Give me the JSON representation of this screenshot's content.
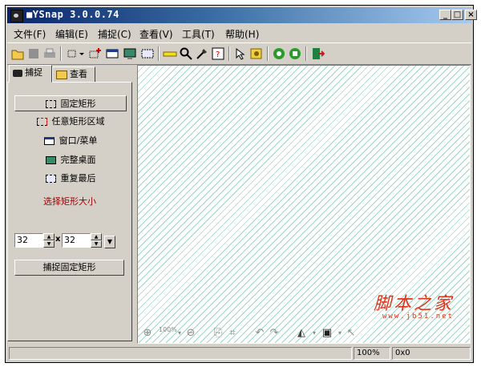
{
  "window": {
    "title": "■YSnap 3.0.0.74"
  },
  "title_buttons": {
    "minimize": "_",
    "maximize": "□",
    "close": "×"
  },
  "menu": [
    "文件(F)",
    "编辑(E)",
    "捕捉(C)",
    "查看(V)",
    "工具(T)",
    "帮助(H)"
  ],
  "tabs": [
    {
      "label": "捕捉",
      "active": true
    },
    {
      "label": "查看",
      "active": false
    }
  ],
  "modes": [
    {
      "label": "固定矩形",
      "icon": "fixed-rect-icon",
      "selected": true
    },
    {
      "label": "任意矩形区域",
      "icon": "free-rect-icon",
      "selected": false
    },
    {
      "label": "窗口/菜单",
      "icon": "window-icon",
      "selected": false
    },
    {
      "label": "完整桌面",
      "icon": "desktop-icon",
      "selected": false
    },
    {
      "label": "重复最后",
      "icon": "repeat-icon",
      "selected": false
    }
  ],
  "size_section": {
    "title": "选择矩形大小",
    "width": "32",
    "x": "x",
    "height": "32"
  },
  "capture_button": "捕捉固定矩形",
  "canvas_toolbar": {
    "zoom_label": "100%"
  },
  "watermark": {
    "text": "脚本之家",
    "url": "www.jb51.net"
  },
  "status": {
    "zoom": "100%",
    "size": "0x0"
  },
  "colors": {
    "title_start": "#0a246a",
    "title_end": "#a6caf0",
    "accent_red": "#e0341a",
    "hatch": "#9fd6c6",
    "size_title": "#a00000"
  }
}
